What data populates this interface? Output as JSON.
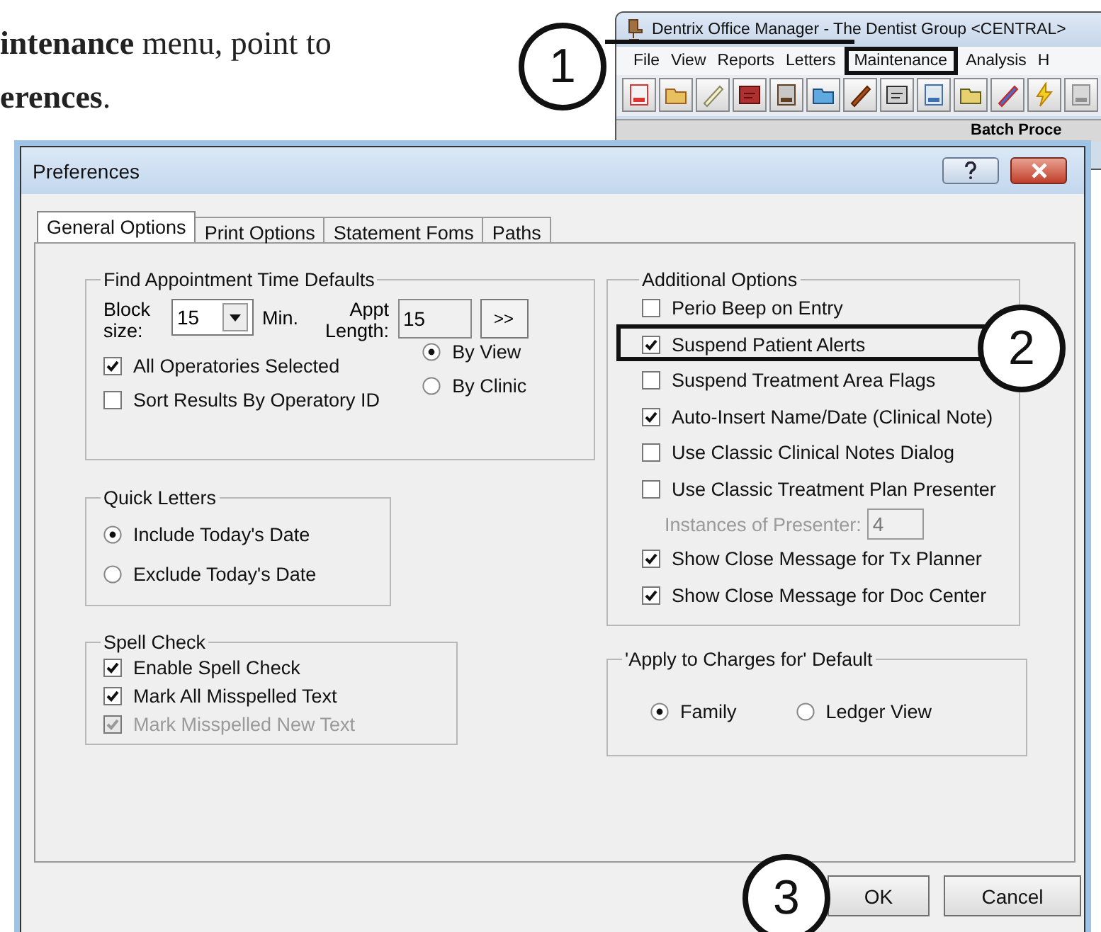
{
  "instruction": {
    "lines": [
      "**intenance** menu, point to",
      "**erences**."
    ]
  },
  "app_window": {
    "title": "Dentrix Office Manager - The Dentist Group <CENTRAL>",
    "menu": [
      {
        "label": "File",
        "highlighted": false
      },
      {
        "label": "View",
        "highlighted": false
      },
      {
        "label": "Reports",
        "highlighted": false
      },
      {
        "label": "Letters",
        "highlighted": false
      },
      {
        "label": "Maintenance",
        "highlighted": true
      },
      {
        "label": "Analysis",
        "highlighted": false
      },
      {
        "label": "H",
        "highlighted": false
      }
    ],
    "panel_header": "Batch Proce"
  },
  "dialog": {
    "title": "Preferences",
    "tabs": [
      {
        "label": "General Options",
        "selected": true
      },
      {
        "label": "Print Options",
        "selected": false
      },
      {
        "label": "Statement Foms",
        "selected": false
      },
      {
        "label": "Paths",
        "selected": false
      }
    ],
    "find_appointment": {
      "title": "Find Appointment Time Defaults",
      "block_size_label": "Block size:",
      "block_size": "15",
      "minutes_unit": "Min.",
      "appt_length_label": "Appt Length:",
      "appt_length": "15",
      "more_button": ">>",
      "options": [
        {
          "label": "All Operatories Selected",
          "checked": true
        },
        {
          "label": "Sort Results By Operatory ID",
          "checked": false
        }
      ],
      "view_modes": [
        {
          "label": "By View",
          "selected": true
        },
        {
          "label": "By Clinic",
          "selected": false
        }
      ]
    },
    "quick_letters": {
      "title": "Quick Letters",
      "options": [
        {
          "label": "Include Today's Date",
          "selected": true
        },
        {
          "label": "Exclude Today's Date",
          "selected": false
        }
      ]
    },
    "spell_check": {
      "title": "Spell Check",
      "options": [
        {
          "label": "Enable Spell Check",
          "checked": true,
          "disabled": false
        },
        {
          "label": "Mark All Misspelled Text",
          "checked": true,
          "disabled": false
        },
        {
          "label": "Mark Misspelled New Text",
          "checked": true,
          "disabled": true
        }
      ]
    },
    "additional_options": {
      "title": "Additional Options",
      "items": [
        {
          "kind": "checkbox",
          "label": "Perio Beep on Entry",
          "checked": false,
          "highlighted": false
        },
        {
          "kind": "checkbox",
          "label": "Suspend Patient Alerts",
          "checked": true,
          "highlighted": true
        },
        {
          "kind": "checkbox",
          "label": "Suspend Treatment Area Flags",
          "checked": false,
          "highlighted": false
        },
        {
          "kind": "checkbox",
          "label": "Auto-Insert Name/Date (Clinical Note)",
          "checked": true,
          "highlighted": false
        },
        {
          "kind": "checkbox",
          "label": "Use Classic Clinical Notes Dialog",
          "checked": false,
          "highlighted": false
        },
        {
          "kind": "checkbox",
          "label": "Use Classic Treatment Plan Presenter",
          "checked": false,
          "highlighted": false
        },
        {
          "kind": "number",
          "label": "Instances of Presenter:",
          "value": "4",
          "disabled": true
        },
        {
          "kind": "checkbox",
          "label": "Show Close Message for Tx Planner",
          "checked": true,
          "highlighted": false
        },
        {
          "kind": "checkbox",
          "label": "Show Close Message for Doc Center",
          "checked": true,
          "highlighted": false
        }
      ]
    },
    "apply_charges": {
      "title": "'Apply to Charges for' Default",
      "options": [
        {
          "label": "Family",
          "selected": true
        },
        {
          "label": "Ledger View",
          "selected": false
        }
      ]
    },
    "buttons": [
      {
        "label": "OK"
      },
      {
        "label": "Cancel"
      }
    ]
  },
  "callouts": [
    {
      "number": "1"
    },
    {
      "number": "2"
    },
    {
      "number": "3"
    }
  ]
}
